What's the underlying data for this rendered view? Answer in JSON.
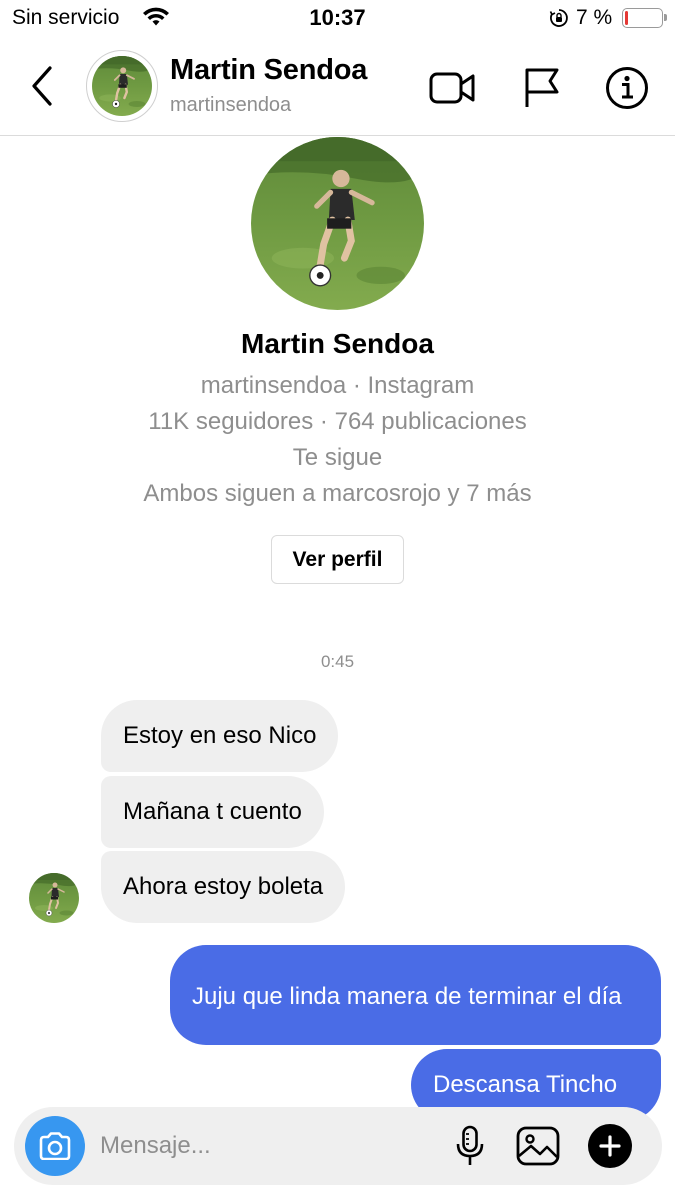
{
  "status_bar": {
    "carrier": "Sin servicio",
    "time": "10:37",
    "battery_percent": "7 %",
    "battery_level": 0.07,
    "icons": [
      "wifi-icon",
      "rotation-lock-icon",
      "battery-icon"
    ]
  },
  "header": {
    "name": "Martin Sendoa",
    "username": "martinsendoa",
    "icons": [
      "back-arrow-icon",
      "video-call-icon",
      "flag-icon",
      "info-icon"
    ]
  },
  "profile": {
    "name": "Martin Sendoa",
    "source_line": "martinsendoa · Instagram",
    "stats_line": "11K seguidores · 764 publicaciones",
    "follow_status": "Te sigue",
    "mutual_line": "Ambos siguen a marcosrojo y 7 más",
    "view_profile_label": "Ver perfil"
  },
  "conversation": {
    "timestamp": "0:45",
    "incoming": [
      {
        "text": "Estoy en eso Nico"
      },
      {
        "text": "Mañana t cuento"
      },
      {
        "text": "Ahora estoy boleta"
      }
    ],
    "outgoing": [
      {
        "text": "Juju que linda manera de terminar el día"
      },
      {
        "text": "Descansa Tincho"
      }
    ]
  },
  "composer": {
    "placeholder": "Mensaje...",
    "icons": [
      "camera-icon",
      "microphone-icon",
      "gallery-icon",
      "plus-icon"
    ]
  },
  "colors": {
    "outgoing_bubble": "#4a6ce6",
    "incoming_bubble": "#efefef",
    "camera_button": "#3797f0",
    "secondary_text": "#8e8e8e",
    "battery_low": "#e53935"
  }
}
